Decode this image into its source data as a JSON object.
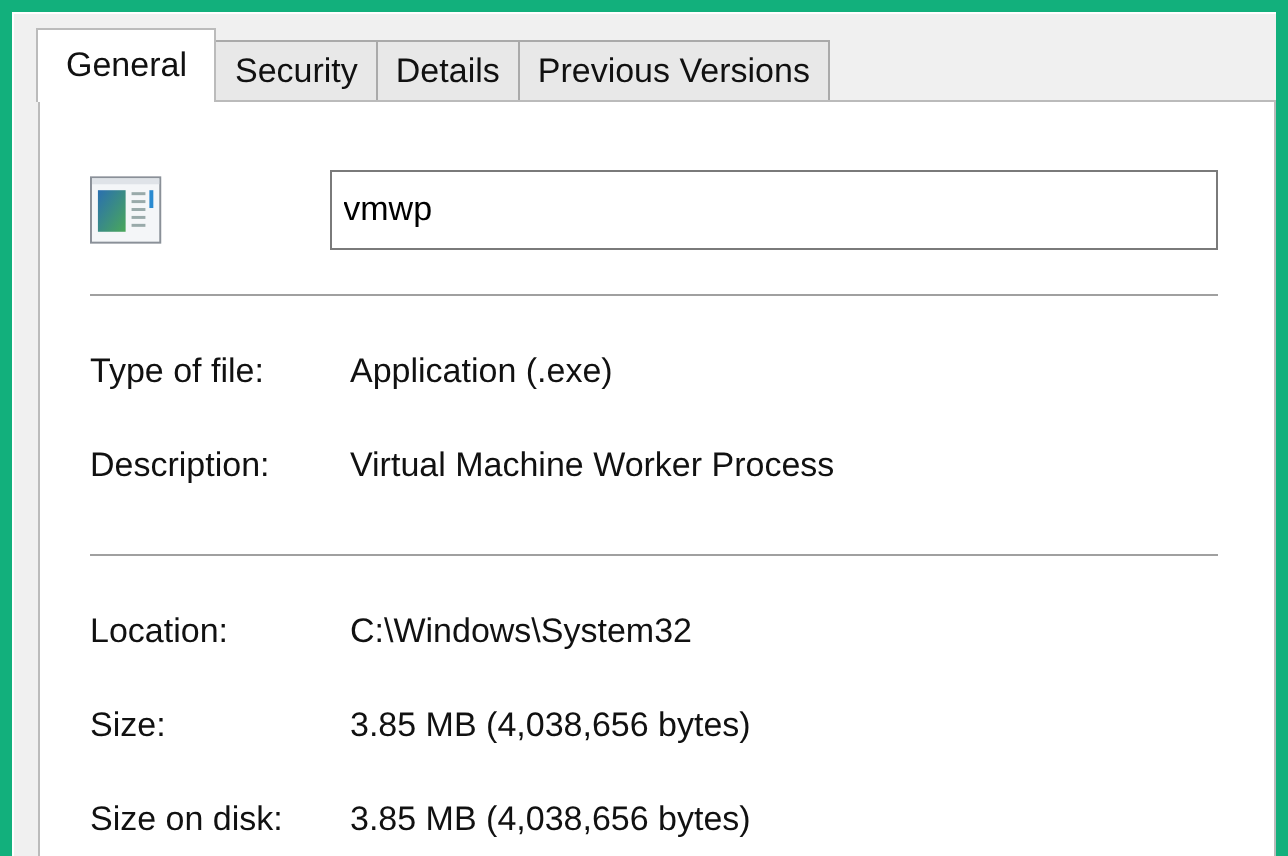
{
  "tabs": [
    {
      "label": "General",
      "selected": true
    },
    {
      "label": "Security",
      "selected": false
    },
    {
      "label": "Details",
      "selected": false
    },
    {
      "label": "Previous Versions",
      "selected": false
    }
  ],
  "name_field": {
    "value": "vmwp"
  },
  "groups": [
    [
      {
        "label": "Type of file:",
        "value": "Application (.exe)"
      },
      {
        "label": "Description:",
        "value": "Virtual Machine Worker Process"
      }
    ],
    [
      {
        "label": "Location:",
        "value": "C:\\Windows\\System32"
      },
      {
        "label": "Size:",
        "value": "3.85 MB (4,038,656 bytes)"
      },
      {
        "label": "Size on disk:",
        "value": "3.85 MB (4,038,656 bytes)"
      }
    ]
  ]
}
